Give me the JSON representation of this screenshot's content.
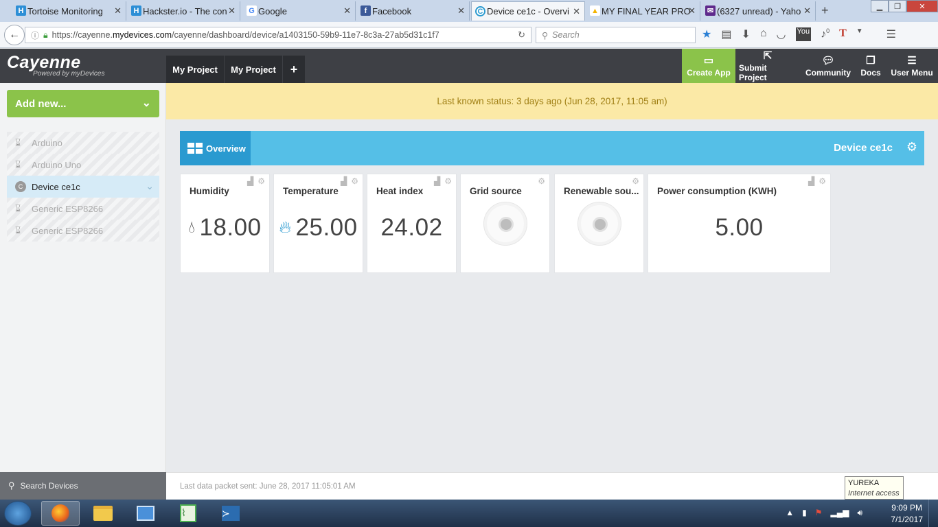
{
  "browser": {
    "tabs": [
      {
        "label": "Tortoise Monitoring",
        "fav_color": "#2d8fd6",
        "fav_glyph": "H"
      },
      {
        "label": "Hackster.io - The con",
        "fav_color": "#2d8fd6",
        "fav_glyph": "H"
      },
      {
        "label": "Google",
        "fav_color": "#ffffff",
        "fav_glyph": "G"
      },
      {
        "label": "Facebook",
        "fav_color": "#3b5998",
        "fav_glyph": "f"
      },
      {
        "label": "Device ce1c - Overvi",
        "fav_color": "#ffffff",
        "fav_glyph": "C"
      },
      {
        "label": "MY FINAL YEAR PRO",
        "fav_color": "#ffffff",
        "fav_glyph": "▲"
      },
      {
        "label": "(6327 unread) - Yaho",
        "fav_color": "#5f2a8c",
        "fav_glyph": "✉"
      }
    ],
    "url_prefix": "https://cayenne.",
    "url_domain": "mydevices.com",
    "url_path": "/cayenne/dashboard/device/a1403150-59b9-11e7-8c3a-27ab5d31c1f7",
    "search_placeholder": "Search",
    "badge_count": "0"
  },
  "header": {
    "logo": "Cayenne",
    "logo_sub": "Powered by myDevices",
    "project_tabs": [
      "My Project",
      "My Project"
    ],
    "add_tab": "+",
    "buttons": [
      "Create App",
      "Submit Project",
      "Community",
      "Docs",
      "User Menu"
    ]
  },
  "sidebar": {
    "add_new": "Add new...",
    "devices": [
      {
        "label": "Arduino"
      },
      {
        "label": "Arduino Uno"
      },
      {
        "label": "Device ce1c"
      },
      {
        "label": "Generic ESP8266"
      },
      {
        "label": "Generic ESP8266"
      }
    ],
    "search": "Search Devices"
  },
  "main": {
    "status": "Last known status: 3 days ago (Jun 28, 2017, 11:05 am)",
    "overview": "Overview",
    "device_name": "Device ce1c",
    "widgets": [
      {
        "title": "Humidity",
        "value": "18.00",
        "icon": "drop-icon",
        "icon_color": "#333333"
      },
      {
        "title": "Temperature",
        "value": "25.00",
        "icon": "flame-icon",
        "icon_color": "#2a9ad0"
      },
      {
        "title": "Heat index",
        "value": "24.02"
      },
      {
        "title": "Grid source"
      },
      {
        "title": "Renewable sou..."
      },
      {
        "title": "Power consumption (KWH)",
        "value": "5.00"
      }
    ],
    "last_packet": "Last data packet sent: June 28, 2017 11:05:01 AM"
  },
  "tooltip": {
    "title": "YUREKA",
    "sub": "Internet access"
  },
  "taskbar": {
    "time": "9:09 PM",
    "date": "7/1/2017"
  },
  "colors": {
    "green": "#8bc34a",
    "blue": "#55bfe7",
    "status_bg": "#fbe9a6"
  }
}
